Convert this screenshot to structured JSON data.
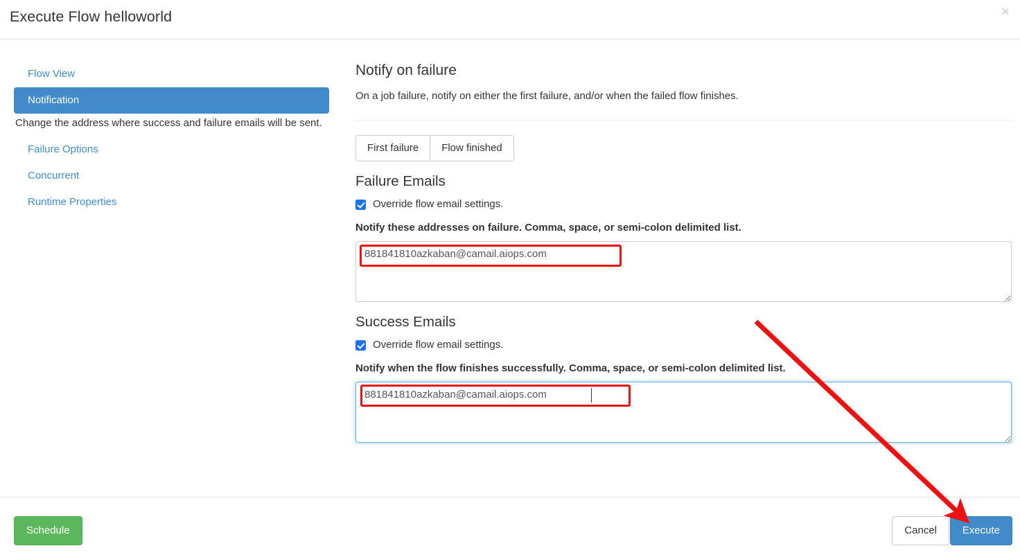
{
  "window": {
    "title": "Execute Flow helloworld",
    "close_icon": "close-icon",
    "close_glyph": "×"
  },
  "sidebar": {
    "items": [
      {
        "label": "Flow View",
        "active": false
      },
      {
        "label": "Notification",
        "active": true
      },
      {
        "label": "Failure Options",
        "active": false
      },
      {
        "label": "Concurrent",
        "active": false
      },
      {
        "label": "Runtime Properties",
        "active": false
      }
    ],
    "active_description": "Change the address where success and failure emails will be sent."
  },
  "main": {
    "heading": "Notify on failure",
    "subheading": "On a job failure, notify on either the first failure, and/or when the failed flow finishes.",
    "notify_toggle": {
      "options": [
        {
          "label": "First failure",
          "selected": false
        },
        {
          "label": "Flow finished",
          "selected": false
        }
      ]
    },
    "failure_emails": {
      "title": "Failure Emails",
      "override_label": "Override flow email settings.",
      "override_checked": true,
      "field_label": "Notify these addresses on failure. Comma, space, or semi-colon delimited list.",
      "value": "881841810azkaban@camail.aiops.com",
      "placeholder": "",
      "focused": false
    },
    "success_emails": {
      "title": "Success Emails",
      "override_label": "Override flow email settings.",
      "override_checked": true,
      "field_label": "Notify when the flow finishes successfully. Comma, space, or semi-colon delimited list.",
      "value": "881841810azkaban@camail.aiops.com",
      "placeholder": "",
      "focused": true
    }
  },
  "footer": {
    "schedule_label": "Schedule",
    "cancel_label": "Cancel",
    "execute_label": "Execute"
  },
  "annotations": {
    "arrow_color": "#ee1111",
    "highlight_color": "#ee1111"
  }
}
